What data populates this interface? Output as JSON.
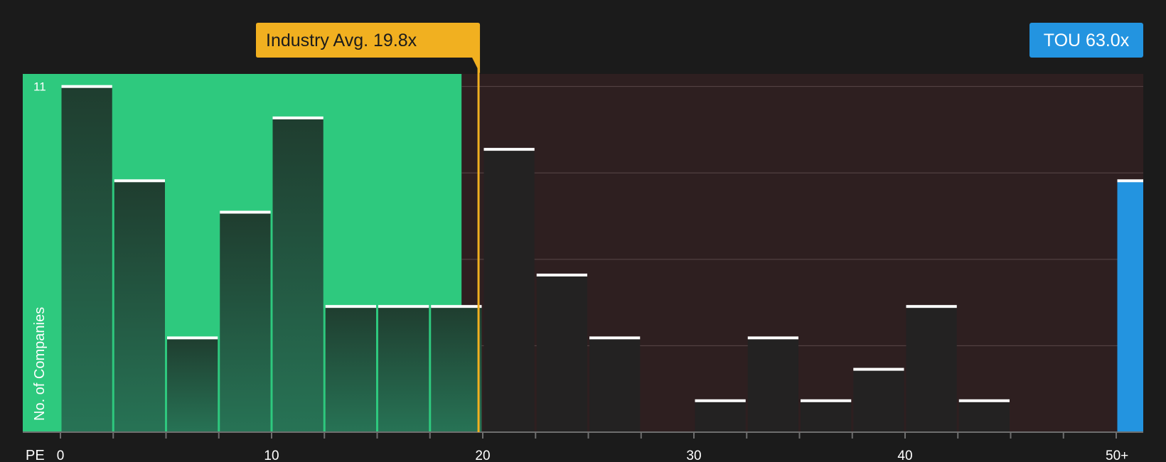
{
  "chart_data": {
    "type": "bar",
    "xlabel": "PE",
    "ylabel": "No. of Companies",
    "x_range": [
      0,
      51.25
    ],
    "ylim": [
      0,
      11.4
    ],
    "y_ticks": [
      0,
      2.75,
      5.5,
      8.25,
      11
    ],
    "y_tick_labels": [
      {
        "value": 11,
        "label": "11"
      }
    ],
    "x_ticks": [
      0,
      2.5,
      5,
      7.5,
      10,
      12.5,
      15,
      17.5,
      20,
      22.5,
      25,
      27.5,
      30,
      32.5,
      35,
      37.5,
      40,
      42.5,
      45,
      47.5,
      50
    ],
    "x_tick_labels": [
      {
        "value": 0,
        "label": "0"
      },
      {
        "value": 10,
        "label": "10"
      },
      {
        "value": 20,
        "label": "20"
      },
      {
        "value": 30,
        "label": "30"
      },
      {
        "value": 40,
        "label": "40"
      },
      {
        "value": 50,
        "label": "50+"
      }
    ],
    "bin_width": 2.5,
    "bins": [
      {
        "start": 0,
        "count": 11
      },
      {
        "start": 2.5,
        "count": 8
      },
      {
        "start": 5,
        "count": 3
      },
      {
        "start": 7.5,
        "count": 7
      },
      {
        "start": 10,
        "count": 10
      },
      {
        "start": 12.5,
        "count": 4
      },
      {
        "start": 15,
        "count": 4
      },
      {
        "start": 17.5,
        "count": 4
      },
      {
        "start": 20,
        "count": 9
      },
      {
        "start": 22.5,
        "count": 5
      },
      {
        "start": 25,
        "count": 3
      },
      {
        "start": 27.5,
        "count": 0
      },
      {
        "start": 30,
        "count": 1
      },
      {
        "start": 32.5,
        "count": 3
      },
      {
        "start": 35,
        "count": 1
      },
      {
        "start": 37.5,
        "count": 2
      },
      {
        "start": 40,
        "count": 4
      },
      {
        "start": 42.5,
        "count": 1
      },
      {
        "start": 45,
        "count": 0
      },
      {
        "start": 47.5,
        "count": 0
      },
      {
        "start": 50,
        "count": 8,
        "highlight": true
      }
    ],
    "industry_avg": {
      "value": 19.8,
      "label": "Industry Avg. 19.8x"
    },
    "company": {
      "value": 63.0,
      "label": "TOU 63.0x"
    },
    "grid": true,
    "colors": {
      "background": "#1b1b1b",
      "below_avg_region": "#2ec97e",
      "above_avg_region": "#2e1f20",
      "bar_below": "#234d38",
      "bar_above": "#232222",
      "bar_cap": "#ffffff",
      "avg_line": "#f1b020",
      "avg_label_bg": "#f1b020",
      "avg_label_text": "#1b1b1b",
      "company_bar": "#2394e0",
      "company_label_bg": "#2394e0",
      "company_label_text": "#ffffff",
      "grid": "#5a4848",
      "axis": "#6e6e6e"
    }
  }
}
